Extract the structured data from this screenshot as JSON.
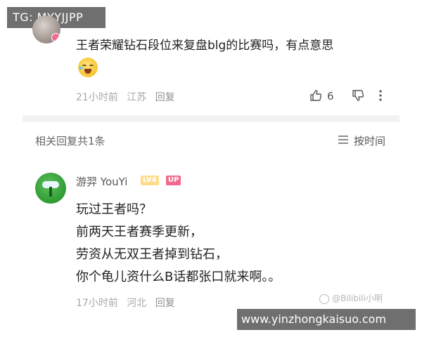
{
  "watermarks": {
    "tg": "TG: MYYJJPP",
    "weibo": "@Bilibili小明",
    "site": "www.yinzhongkaisuo.com"
  },
  "comment": {
    "text": "王者荣耀钻石段位来复盘blg的比赛吗，有点意思",
    "emoji": "grinning-tears-emoji",
    "time": "21小时前",
    "location": "江苏",
    "reply_label": "回复",
    "like_count": "6"
  },
  "replies_header": {
    "count_label": "相关回复共1条",
    "sort_label": "按时间"
  },
  "reply": {
    "author": "游羿 YouYi",
    "level": "LV4",
    "up_badge": "UP",
    "lines": [
      "玩过王者吗？",
      "前两天王者赛季更新，",
      "劳资从无双王者掉到钻石，",
      "你个龟儿资什么B话都张口就来啊。。"
    ],
    "time": "17小时前",
    "location": "河北",
    "reply_label": "回复"
  },
  "colors": {
    "pink_badge": "#f26a8d",
    "level_badge": "#ffdc8a",
    "meta_gray": "#a8a8a8",
    "divider": "#f2f2f2"
  }
}
